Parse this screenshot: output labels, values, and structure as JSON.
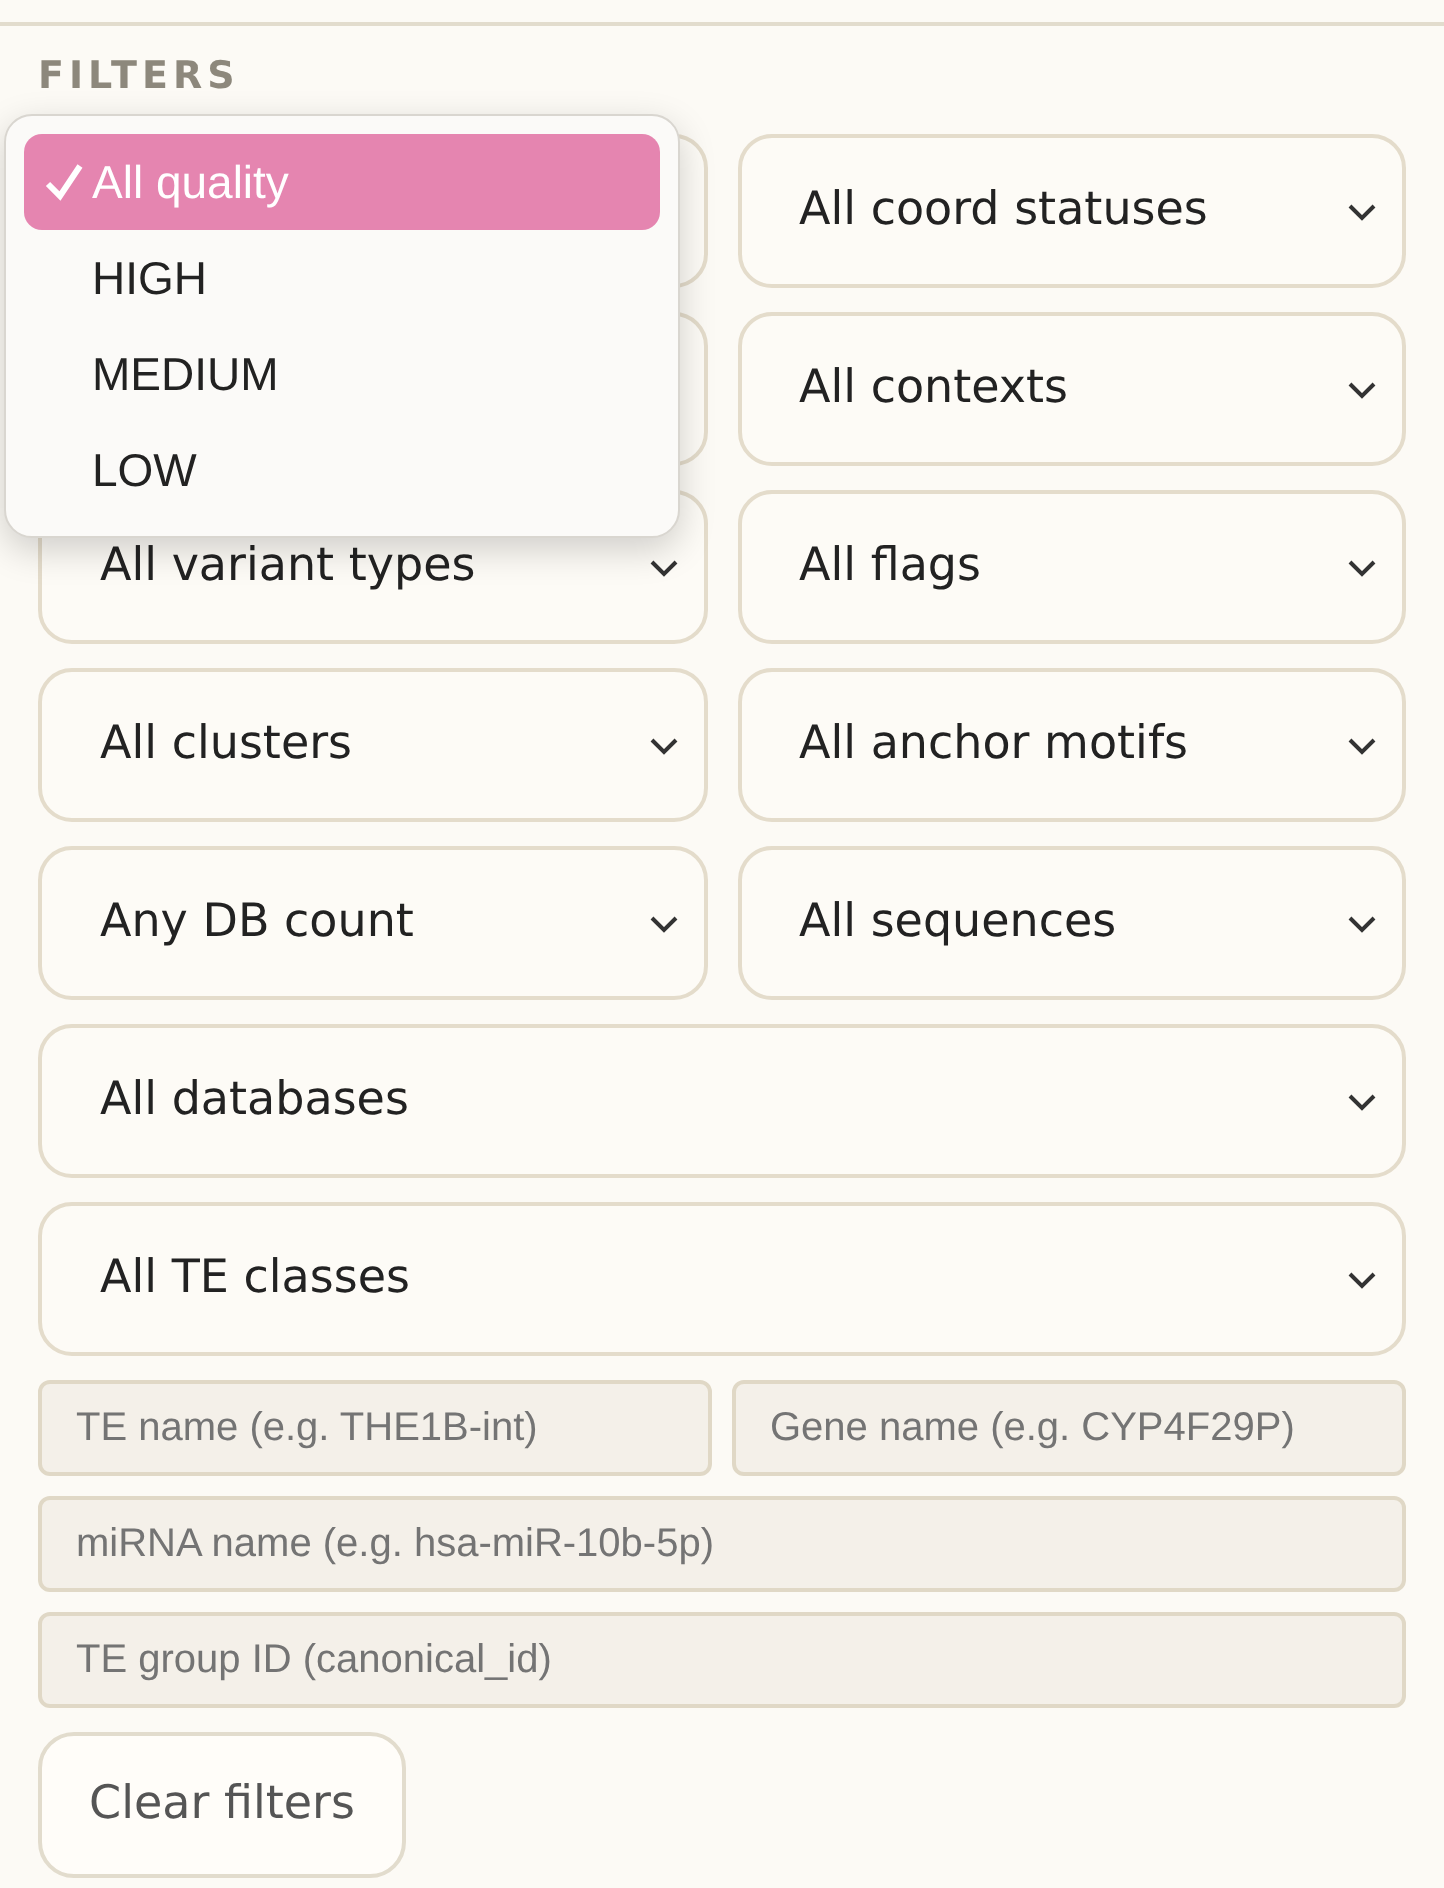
{
  "heading": "FILTERS",
  "selects": [
    {
      "wide": false
    },
    {
      "value": "All coord statuses",
      "wide": false
    },
    {
      "wide": false
    },
    {
      "value": "All contexts",
      "wide": false
    },
    {
      "value": "All variant types",
      "wide": false
    },
    {
      "value": "All flags",
      "wide": false
    },
    {
      "value": "All clusters",
      "wide": false
    },
    {
      "value": "All anchor motifs",
      "wide": false
    },
    {
      "value": "Any DB count",
      "wide": false
    },
    {
      "value": "All sequences",
      "wide": false
    },
    {
      "value": "All databases",
      "wide": true
    },
    {
      "value": "All TE classes",
      "wide": true
    }
  ],
  "dropdown_menu": {
    "options": [
      {
        "label": "All quality",
        "selected": true
      },
      {
        "label": "HIGH",
        "selected": false
      },
      {
        "label": "MEDIUM",
        "selected": false
      },
      {
        "label": "LOW",
        "selected": false
      }
    ]
  },
  "text_fields": [
    {
      "placeholder": "TE name (e.g. THE1B-int)",
      "wide": false
    },
    {
      "placeholder": "Gene name (e.g. CYP4F29P)",
      "wide": false
    },
    {
      "placeholder": "miRNA name (e.g. hsa-miR-10b-5p)",
      "wide": true
    },
    {
      "placeholder": "TE group ID (canonical_id)",
      "wide": true
    }
  ],
  "clear_button": {
    "label": "Clear filters"
  }
}
